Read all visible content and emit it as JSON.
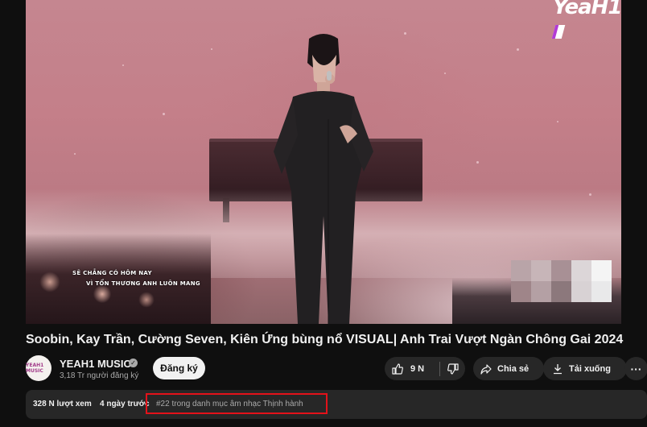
{
  "player": {
    "brand_logo": "YeaH1",
    "lyrics": [
      "SẼ CHẲNG CÓ HÔM NAY",
      "VÌ TỔN THƯƠNG ANH LUÔN MANG"
    ]
  },
  "video": {
    "title": "Soobin, Kay Trần, Cường Seven, Kiên Ứng bùng nổ VISUAL| Anh Trai Vượt Ngàn Chông Gai 2024"
  },
  "channel": {
    "avatar_text": "YEAH1 MUSIC",
    "name": "YEAH1 MUSIC",
    "subscribers": "3,18 Tr người đăng ký",
    "subscribe_label": "Đăng ký"
  },
  "actions": {
    "like_count": "9 N",
    "share_label": "Chia sẻ",
    "download_label": "Tải xuống",
    "more_label": "···"
  },
  "description": {
    "views": "328 N lượt xem",
    "date": "4 ngày trước",
    "trending": "#22 trong danh mục âm nhạc Thịnh hành"
  },
  "colors": {
    "background": "#0f0f0f",
    "pill": "#272727",
    "highlight": "#e3121a"
  }
}
